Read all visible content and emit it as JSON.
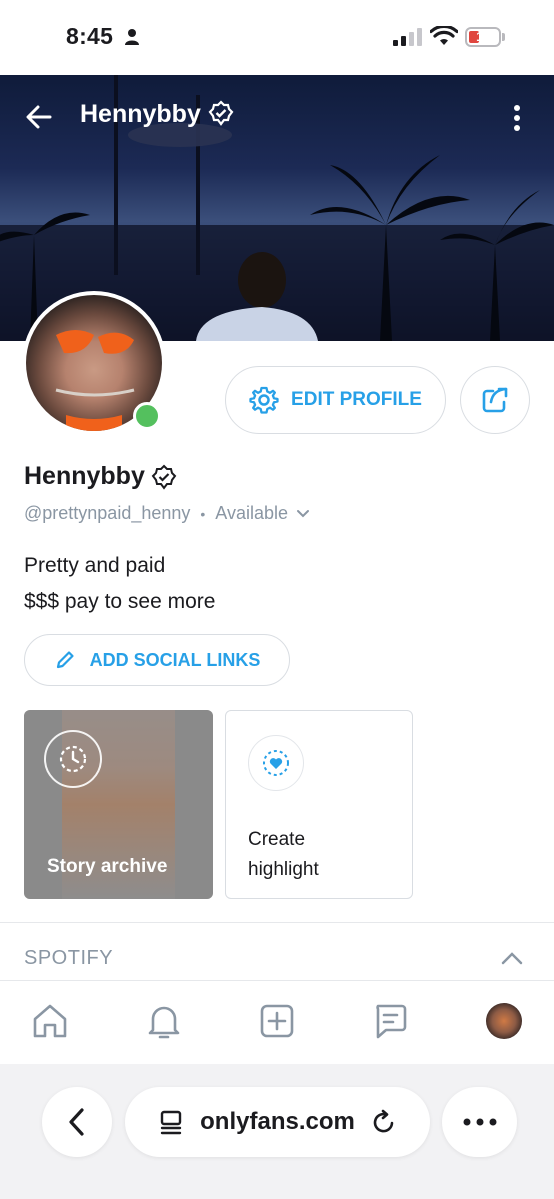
{
  "status_bar": {
    "time": "8:45",
    "battery": "11"
  },
  "header": {
    "title": "Hennybby"
  },
  "profile": {
    "name": "Hennybby",
    "handle": "@prettynpaid_henny",
    "separator": "•",
    "availability": "Available",
    "bio_line1": "Pretty and paid",
    "bio_line2": "$$$ pay to see more"
  },
  "buttons": {
    "edit_profile": "EDIT PROFILE",
    "add_social_links": "ADD SOCIAL LINKS"
  },
  "stories": {
    "archive_label": "Story archive",
    "highlight_label_line1": "Create",
    "highlight_label_line2": "highlight"
  },
  "sections": {
    "spotify": "SPOTIFY"
  },
  "browser": {
    "url": "onlyfans.com"
  },
  "colors": {
    "accent": "#27a0e7",
    "online": "#54c05e",
    "muted": "#8a96a3"
  }
}
